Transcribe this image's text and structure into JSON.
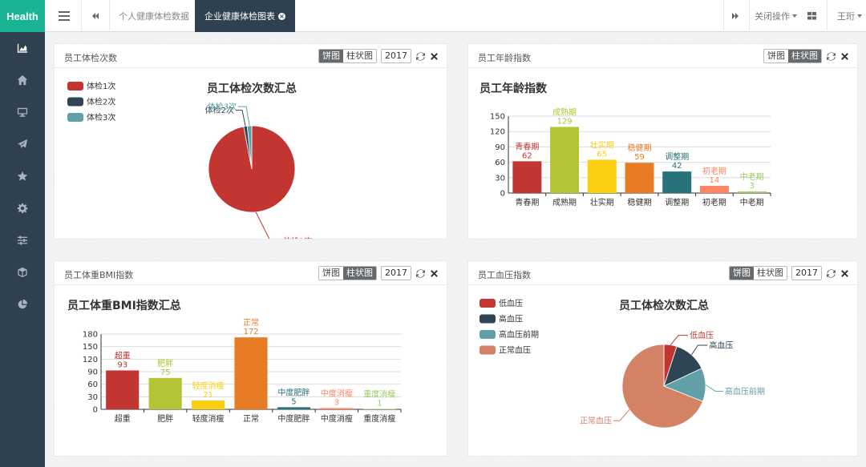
{
  "app": {
    "brand": "Health"
  },
  "sidebar": {
    "icons": [
      "chart-area-icon",
      "home-icon",
      "desktop-icon",
      "paper-plane-icon",
      "star-icon",
      "gear-icon",
      "sliders-icon",
      "cube-icon",
      "pie-chart-icon"
    ]
  },
  "topbar": {
    "tabs": [
      {
        "label": "个人健康体检数据"
      },
      {
        "label": "企业健康体检图表"
      }
    ],
    "close_ops": "关闭操作",
    "user": "王珩"
  },
  "toggles": {
    "pie": "饼图",
    "bar": "柱状图"
  },
  "panels": [
    {
      "title": "员工体检次数",
      "year": "2017",
      "mode": "pie"
    },
    {
      "title": "员工年龄指数",
      "year": "2017",
      "mode": "bar"
    },
    {
      "title": "员工体重BMI指数",
      "year": "2017",
      "mode": "bar"
    },
    {
      "title": "员工血压指数",
      "year": "2017",
      "mode": "pie"
    }
  ],
  "chart_data": [
    {
      "type": "pie",
      "title": "员工体检次数汇总",
      "slices": [
        {
          "name": "体检1次",
          "value": 97,
          "color": "#c23531"
        },
        {
          "name": "体检2次",
          "value": 1.3,
          "color": "#2f4554"
        },
        {
          "name": "体检3次",
          "value": 1.7,
          "color": "#61a0a8"
        }
      ],
      "legend_position": "top-left"
    },
    {
      "type": "bar",
      "title": "员工年龄指数",
      "categories": [
        "青春期",
        "成熟期",
        "壮实期",
        "稳健期",
        "调整期",
        "初老期",
        "中老期"
      ],
      "values": [
        62,
        129,
        65,
        59,
        42,
        14,
        3
      ],
      "colors": [
        "#c23531",
        "#b5c334",
        "#fcce10",
        "#e87c25",
        "#27727b",
        "#fe8463",
        "#9bca63"
      ],
      "ylim": [
        0,
        150
      ],
      "yticks": [
        0,
        30,
        60,
        90,
        120,
        150
      ]
    },
    {
      "type": "bar",
      "title": "员工体重BMI指数汇总",
      "categories": [
        "超重",
        "肥胖",
        "轻度消瘦",
        "正常",
        "中度肥胖",
        "中度消瘦",
        "重度消瘦"
      ],
      "values": [
        93,
        75,
        21,
        172,
        5,
        3,
        1
      ],
      "colors": [
        "#c23531",
        "#b5c334",
        "#fcce10",
        "#e87c25",
        "#27727b",
        "#fe8463",
        "#9bca63"
      ],
      "ylim": [
        0,
        180
      ],
      "yticks": [
        0,
        30,
        60,
        90,
        120,
        150,
        180
      ]
    },
    {
      "type": "pie",
      "title": "员工体检次数汇总",
      "slices": [
        {
          "name": "低血压",
          "value": 5,
          "color": "#c23531"
        },
        {
          "name": "高血压",
          "value": 13,
          "color": "#2f4554"
        },
        {
          "name": "高血压前期",
          "value": 13,
          "color": "#61a0a8"
        },
        {
          "name": "正常血压",
          "value": 69,
          "color": "#d48265"
        }
      ],
      "legend_position": "top-left"
    }
  ]
}
